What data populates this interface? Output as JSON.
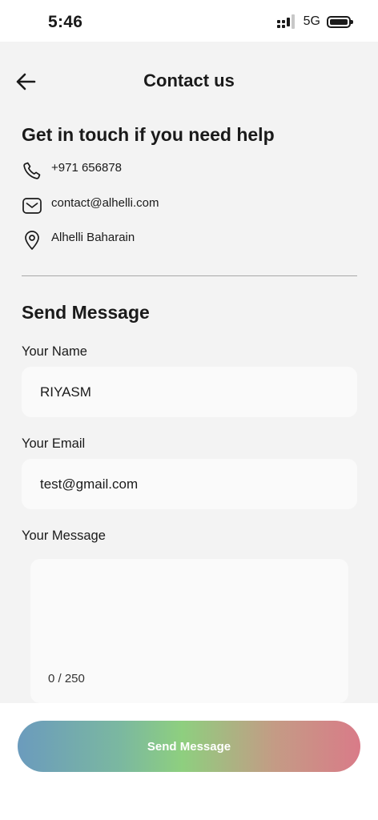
{
  "status_bar": {
    "time": "5:46",
    "network": "5G"
  },
  "header": {
    "title": "Contact us",
    "back_icon": "arrow-left-icon"
  },
  "contact_info": {
    "title": "Get in touch if you need help",
    "phone": "+971 656878",
    "email": "contact@alhelli.com",
    "address": "Alhelli Baharain"
  },
  "form": {
    "title": "Send Message",
    "name_label": "Your Name",
    "name_value": "RIYASM",
    "email_label": "Your Email",
    "email_value": "test@gmail.com",
    "message_label": "Your Message",
    "message_value": "",
    "counter": "0 / 250"
  },
  "actions": {
    "send_label": "Send Message"
  },
  "colors": {
    "background": "#f3f3f3",
    "field": "#fafafa",
    "gradient": [
      "#6b9bbd",
      "#8ecf7f",
      "#d97b88"
    ]
  }
}
